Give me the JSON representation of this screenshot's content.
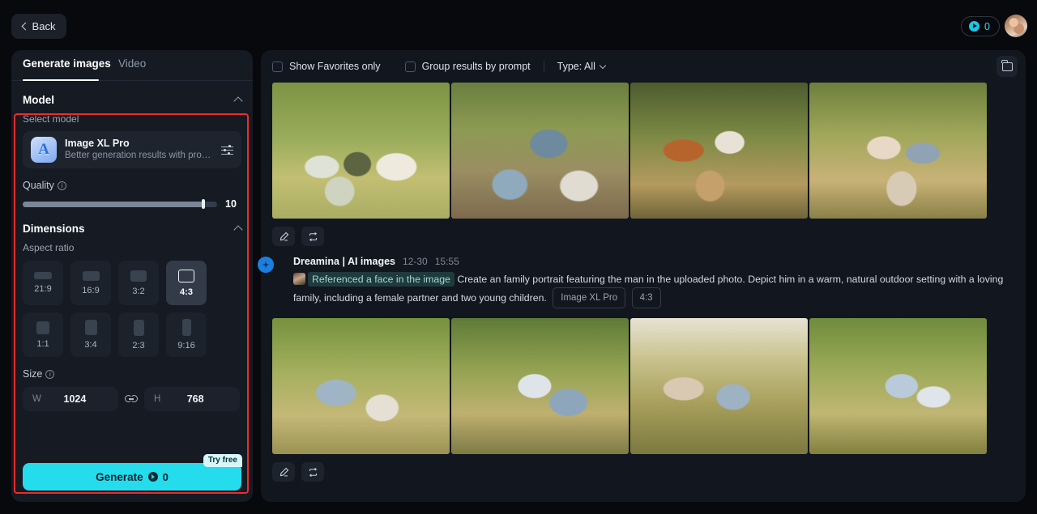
{
  "topbar": {
    "back_label": "Back",
    "credits_count": "0",
    "credit_icon": "coin-icon",
    "avatar_name": "user-avatar"
  },
  "left_panel": {
    "tabs": [
      {
        "label": "Generate images",
        "active": true
      },
      {
        "label": "Video",
        "active": false
      }
    ],
    "model_section": {
      "title": "Model",
      "select_label": "Select model",
      "model_name": "Image XL Pro",
      "model_desc": "Better generation results with profe…",
      "model_icon_glyph": "A",
      "settings_icon": "sliders-icon"
    },
    "quality": {
      "label": "Quality",
      "value": "10",
      "percent": 93
    },
    "dimensions": {
      "title": "Dimensions",
      "aspect_label": "Aspect ratio",
      "ratios": [
        {
          "label": "21:9",
          "w": 22,
          "h": 9,
          "selected": false
        },
        {
          "label": "16:9",
          "w": 21,
          "h": 12,
          "selected": false
        },
        {
          "label": "3:2",
          "w": 20,
          "h": 14,
          "selected": false
        },
        {
          "label": "4:3",
          "w": 20,
          "h": 16,
          "selected": true
        },
        {
          "label": "1:1",
          "w": 16,
          "h": 16,
          "selected": false
        },
        {
          "label": "3:4",
          "w": 15,
          "h": 19,
          "selected": false
        },
        {
          "label": "2:3",
          "w": 13,
          "h": 20,
          "selected": false
        },
        {
          "label": "9:16",
          "w": 11,
          "h": 21,
          "selected": false
        }
      ]
    },
    "size": {
      "label": "Size",
      "width_key": "W",
      "width_value": "1024",
      "height_key": "H",
      "height_value": "768",
      "link_icon": "link-icon"
    },
    "generate": {
      "label": "Generate",
      "cost": "0",
      "badge": "Try free"
    },
    "highlight_color": "#ef2b29"
  },
  "right_panel": {
    "filters": {
      "favorites_label": "Show Favorites only",
      "favorites_checked": false,
      "group_label": "Group results by prompt",
      "group_checked": false,
      "type_label": "Type: All",
      "folder_icon": "folder-icon"
    },
    "results": [
      {
        "images": [
          "im1",
          "im2",
          "im3",
          "im4"
        ],
        "actions": [
          {
            "name": "edit-button",
            "icon": "pencil-icon"
          },
          {
            "name": "regenerate-button",
            "icon": "loop-icon"
          }
        ]
      },
      {
        "images": [
          "im5",
          "im6",
          "im7",
          "im8"
        ],
        "actions": [
          {
            "name": "edit-button",
            "icon": "pencil-icon"
          },
          {
            "name": "regenerate-button",
            "icon": "loop-icon"
          }
        ]
      }
    ],
    "prompt": {
      "app_name": "Dreamina | AI images",
      "date": "12-30",
      "time": "15:55",
      "badge_icon": "sparkle-icon",
      "reference_chip": "Referenced a face in the image",
      "text": "Create an family portrait featuring the man in the uploaded photo. Depict him in a warm, natural outdoor setting with a loving family, including a female partner and two young children.",
      "model_chip": "Image XL Pro",
      "ratio_chip": "4:3"
    }
  }
}
